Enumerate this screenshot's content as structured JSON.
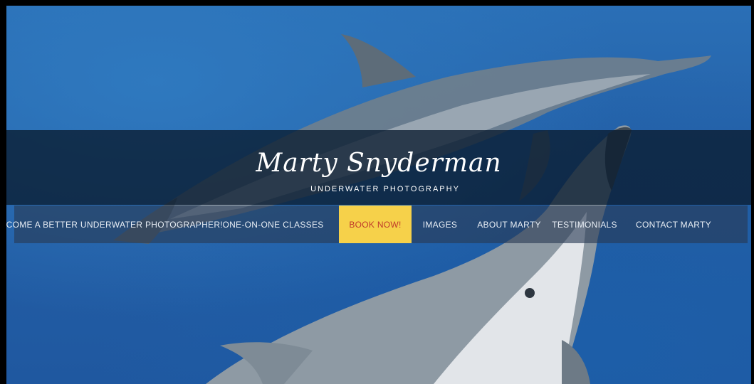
{
  "site": {
    "title": "Marty Snyderman",
    "subtitle": "UNDERWATER PHOTOGRAPHY"
  },
  "nav": {
    "items": [
      {
        "label": "BECOME A BETTER UNDERWATER PHOTOGRAPHER!"
      },
      {
        "label": "ONE-ON-ONE CLASSES"
      },
      {
        "label": "BOOK NOW!",
        "active": true
      },
      {
        "label": "IMAGES"
      },
      {
        "label": "ABOUT MARTY"
      },
      {
        "label": "TESTIMONIALS"
      },
      {
        "label": "CONTACT MARTY"
      }
    ]
  },
  "colors": {
    "accent": "#f6d14a",
    "accent_text": "#c0392b",
    "ocean": "#245fa6"
  }
}
